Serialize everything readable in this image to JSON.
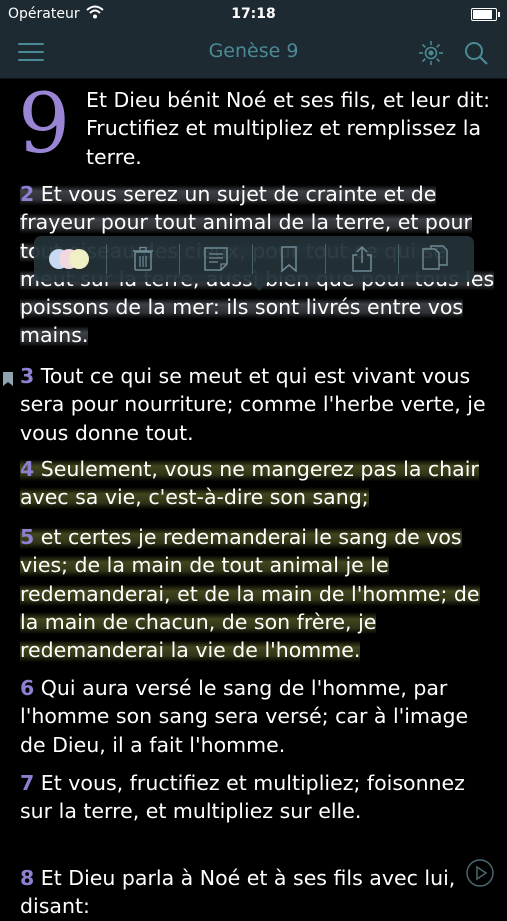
{
  "status_bar": {
    "carrier": "Opérateur",
    "time": "17:18",
    "battery_level": 0.85
  },
  "nav": {
    "title": "Genèse 9",
    "icons": [
      "menu-icon",
      "brightness-icon",
      "search-icon"
    ]
  },
  "chapter": {
    "number": "9",
    "intro": "Et Dieu bénit Noé et ses fils, et leur dit: Fructifiez et multipliez et remplissez la terre."
  },
  "verses": [
    {
      "number": "2",
      "text": "Et vous serez un sujet de crainte et de frayeur pour tout animal de la terre, et pour tout oiseau des cieux, pour tout ce qui se meut sur la terre, aussi bien que pour tous les poissons de la mer: ils sont livrés entre vos mains.",
      "highlight": "#6e767e"
    },
    {
      "number": "3",
      "text": "Tout ce qui se meut et qui est vivant vous sera pour nourriture; comme l'herbe verte, je vous donne tout.",
      "bookmarked": true
    },
    {
      "number": "4",
      "text": "Seulement, vous ne mangerez pas la chair avec sa vie, c'est-à-dire son sang;",
      "highlight": "#5a5c28"
    },
    {
      "number": "5",
      "text": "et certes je redemanderai le sang de vos vies; de la main de tout animal je le redemanderai, et de la main de l'homme; de la main de chacun, de son frère, je redemanderai la vie de l'homme.",
      "highlight": "#5a5c28"
    },
    {
      "number": "6",
      "text": "Qui aura versé le sang de l'homme, par l'homme son sang sera versé; car à l'image de Dieu, il a fait l'homme."
    },
    {
      "number": "7",
      "text": "Et vous, fructifiez et multipliez; foisonnez sur la terre, et multipliez sur elle."
    },
    {
      "number": "8",
      "text": "Et Dieu parla à Noé et à ses fils avec lui, disant:"
    }
  ],
  "toolbar": {
    "actions": [
      "highlight-color",
      "delete",
      "note",
      "bookmark",
      "share",
      "copy"
    ]
  },
  "colors": {
    "nav_bg": "#1d2a31",
    "accent": "#4a8a96",
    "verse_number": "#8f7fd0",
    "drop_cap": "#9a84d4"
  }
}
